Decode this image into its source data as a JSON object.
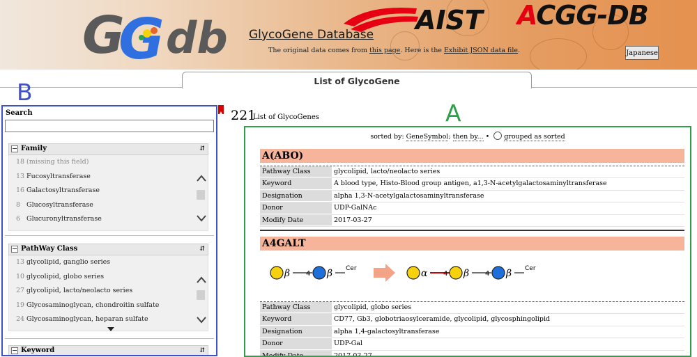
{
  "header": {
    "logo_text": "GGdb",
    "site_title": "GlycoGene Database",
    "source_prefix": "The original data comes from ",
    "source_link": "this page",
    "source_mid": ". Here is the ",
    "json_link": "Exhibit JSON data file",
    "source_suffix": ".",
    "aist_text": "AIST",
    "acgg_a": "A",
    "acgg_rest": "CGG-DB",
    "language_button": "Japanese"
  },
  "tab": {
    "label": "List of GlycoGene"
  },
  "annotations": {
    "b": "B",
    "a": "A"
  },
  "sidebar": {
    "search_label": "Search",
    "search_value": "",
    "facets": [
      {
        "title": "Family",
        "items": [
          {
            "count": "18",
            "label": "(missing this field)"
          },
          {
            "count": "13",
            "label": "Fucosyltransferase"
          },
          {
            "count": "16",
            "label": "Galactosyltransferase"
          },
          {
            "count": "8",
            "label": "Glucosyltransferase"
          },
          {
            "count": "6",
            "label": "Glucuronyltransferase"
          }
        ]
      },
      {
        "title": "PathWay Class",
        "items": [
          {
            "count": "13",
            "label": "glycolipid, ganglio series"
          },
          {
            "count": "10",
            "label": "glycolipid, globo series"
          },
          {
            "count": "27",
            "label": "glycolipid, lacto/neolacto series"
          },
          {
            "count": "19",
            "label": "Glycosaminoglycan, chondroitin sulfate"
          },
          {
            "count": "24",
            "label": "Glycosaminoglycan, heparan sulfate"
          }
        ]
      },
      {
        "title": "Keyword",
        "items": []
      }
    ]
  },
  "results": {
    "count": "221",
    "count_label": "List of GlycoGenes",
    "sort_prefix": "sorted by: ",
    "sort_field": "GeneSymbol",
    "sort_sep": "; ",
    "then_by": "then by...",
    "bullet": " • ",
    "grouped_label": "grouped as sorted",
    "genes": [
      {
        "symbol": "A(ABO)",
        "fields": [
          {
            "key": "Pathway Class",
            "value": "glycolipid, lacto/neolacto series"
          },
          {
            "key": "Keyword",
            "value": "A blood type, Histo-Blood group antigen, a1,3-N-acetylgalactosaminyltransferase"
          },
          {
            "key": "Designation",
            "value": "alpha 1,3-N-acetylgalactosaminyltransferase"
          },
          {
            "key": "Donor",
            "value": "UDP-GalNAc"
          },
          {
            "key": "Modify Date",
            "value": "2017-03-27"
          }
        ]
      },
      {
        "symbol": "A4GALT",
        "glycan": {
          "beta": "β",
          "alpha": "α",
          "link_4": "4",
          "cer": "Cer",
          "colors": {
            "gal": "#f5d10e",
            "glc": "#1e6fd9",
            "arrow": "#f3a386",
            "new_link": "#cc0000"
          }
        },
        "fields": [
          {
            "key": "Pathway Class",
            "value": "glycolipid, globo series"
          },
          {
            "key": "Keyword",
            "value": "CD77, Gb3, globotriaosylceramide, glycolipid, glycosphingolipid"
          },
          {
            "key": "Designation",
            "value": "alpha 1,4-galactosyltransferase"
          },
          {
            "key": "Donor",
            "value": "UDP-Gal"
          },
          {
            "key": "Modify Date",
            "value": "2017-03-27"
          }
        ]
      }
    ]
  },
  "colors": {
    "panel_b_border": "#4050c8",
    "panel_a_border": "#2ea04a",
    "gene_header_bg": "#f6b59a",
    "aist_red": "#e60012",
    "bookmark_red": "#d80000"
  }
}
